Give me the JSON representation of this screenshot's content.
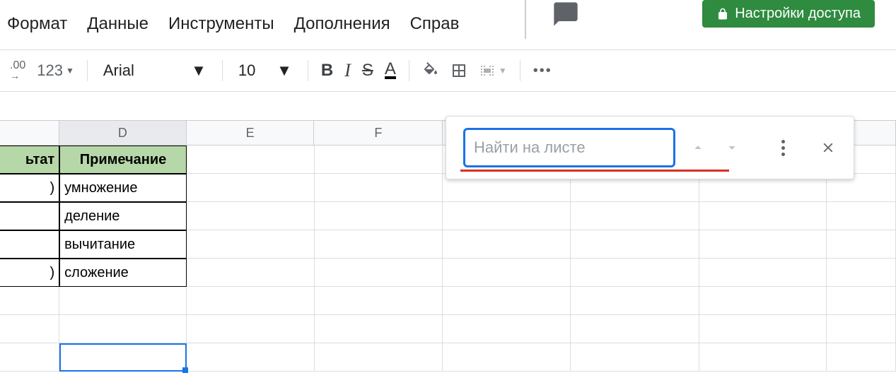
{
  "share": {
    "label": "Настройки доступа"
  },
  "menu": {
    "format": "Формат",
    "data": "Данные",
    "tools": "Инструменты",
    "addons": "Дополнения",
    "help": "Справ"
  },
  "toolbar": {
    "decimal": ".00",
    "format123": "123",
    "font": "Arial",
    "fontSize": "10",
    "bold": "B",
    "italic": "I",
    "strike": "S",
    "textColor": "A"
  },
  "columns": {
    "d": "D",
    "e": "E",
    "f": "F"
  },
  "table": {
    "headerLeft": "ьтат",
    "headerD": "Примечание",
    "rows": [
      {
        "left": ")",
        "d": "умножение"
      },
      {
        "left": "",
        "d": "деление"
      },
      {
        "left": "",
        "d": "вычитание"
      },
      {
        "left": ")",
        "d": "сложение"
      }
    ]
  },
  "find": {
    "placeholder": "Найти на листе"
  }
}
